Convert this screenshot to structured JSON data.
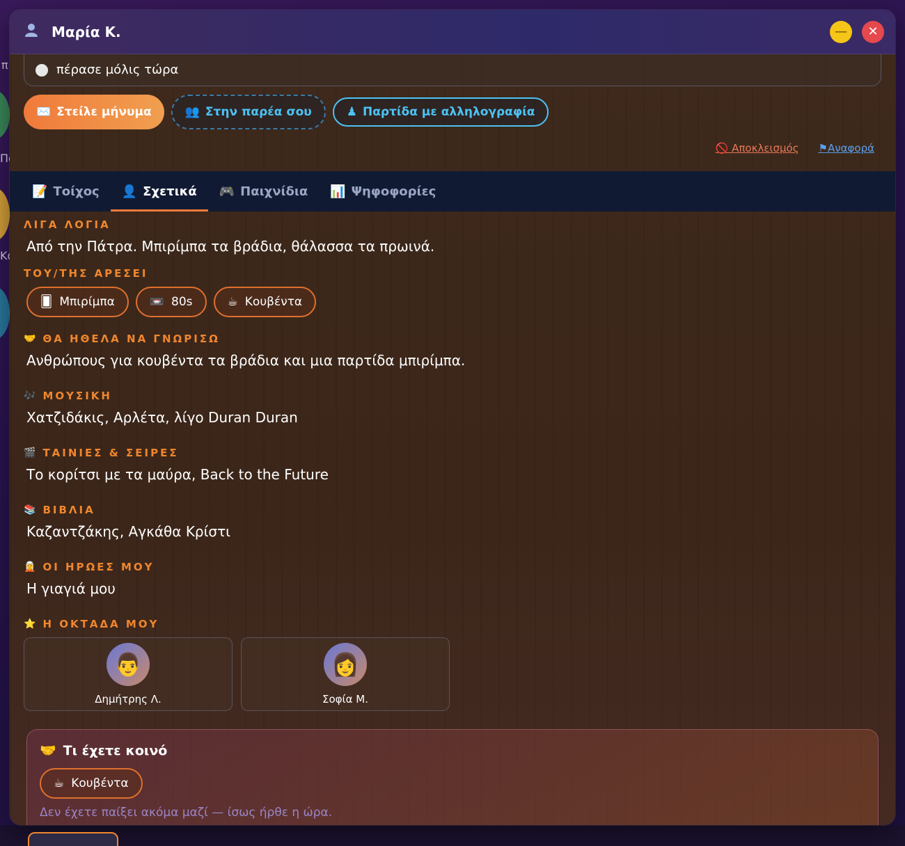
{
  "window": {
    "title": "Μαρία Κ.",
    "user_icon": "user-icon",
    "minimize_symbol": "—",
    "close_symbol": "✕"
  },
  "status": {
    "text": "πέρασε μόλις τώρα"
  },
  "actions": {
    "send_message": "Στείλε μήνυμα",
    "send_message_icon": "✉️",
    "add_friend": "Στην παρέα σου",
    "add_friend_icon": "👥",
    "correspondence_game": "Παρτίδα με αλληλογραφία",
    "correspondence_game_icon": "♟"
  },
  "moderation": {
    "block": "Αποκλεισμός",
    "block_icon": "🚫",
    "report": "Αναφορά",
    "report_icon": "⚑"
  },
  "tabs": [
    {
      "icon": "📝",
      "label": "Τοίχος"
    },
    {
      "icon": "👤",
      "label": "Σχετικά"
    },
    {
      "icon": "🎮",
      "label": "Παιχνίδια"
    },
    {
      "icon": "📊",
      "label": "Ψηφοφορίες"
    }
  ],
  "active_tab": "Σχετικά",
  "about": {
    "bio_label": "ΛΙΓΑ ΛΟΓΙΑ",
    "bio": "Από την Πάτρα. Μπιρίμπα τα βράδια, θάλασσα τα πρωινά.",
    "likes_label": "ΤΟΥ/ΤΗΣ ΑΡΕΣΕΙ",
    "likes": [
      {
        "icon": "🂠",
        "label": "Μπιρίμπα"
      },
      {
        "icon": "📼",
        "label": "80s"
      },
      {
        "icon": "☕",
        "label": "Κουβέντα"
      }
    ],
    "meet_icon": "🤝",
    "meet_label": "ΘΑ ΗΘΕΛΑ ΝΑ ΓΝΩΡΙΣΩ",
    "meet": "Ανθρώπους για κουβέντα τα βράδια και μια παρτίδα μπιρίμπα.",
    "music_icon": "🎶",
    "music_label": "ΜΟΥΣΙΚΗ",
    "music": "Χατζιδάκις, Αρλέτα, λίγο Duran Duran",
    "movies_icon": "🎬",
    "movies_label": "ΤΑΙΝΙΕΣ & ΣΕΙΡΕΣ",
    "movies": "Το κορίτσι με τα μαύρα, Back to the Future",
    "books_icon": "📚",
    "books_label": "ΒΙΒΛΙΑ",
    "books": "Καζαντζάκης, Αγκάθα Κρίστι",
    "heroes_icon": "🧝",
    "heroes_label": "ΟΙ ΗΡΩΕΣ ΜΟΥ",
    "heroes": "Η γιαγιά μου",
    "team_icon": "⭐",
    "team_label": "Η ΟΚΤΑΔΑ ΜΟΥ",
    "team": [
      {
        "avatar": "👨",
        "name": "Δημήτρης Λ."
      },
      {
        "avatar": "👩",
        "name": "Σοφία Μ."
      }
    ]
  },
  "common": {
    "icon": "🤝",
    "title": "Τι έχετε κοινό",
    "chip_icon": "☕",
    "chip": "Κουβέντα",
    "note": "Δεν έχετε παίξει ακόμα μαζί — ίσως ήρθε η ώρα."
  },
  "colors": {
    "accent": "#f0862e",
    "link": "#4cc3f5",
    "tab_bar": "#101a33"
  }
}
